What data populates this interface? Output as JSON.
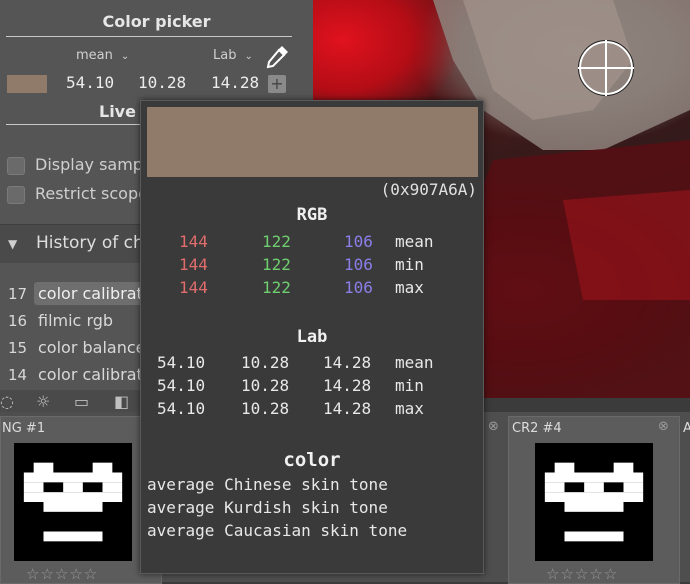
{
  "colors": {
    "sample": "#907A6A",
    "r": "#e06c6c",
    "g": "#6fcf6f",
    "b": "#8a7ee8"
  },
  "picker": {
    "title": "Color picker",
    "stat_mode": "mean",
    "color_mode": "Lab",
    "values": [
      "54.10",
      "10.28",
      "14.28"
    ],
    "add_label": "+"
  },
  "live_samples": {
    "title": "Live s",
    "display_samples": "Display sample",
    "restrict_scope": "Restrict scope"
  },
  "history": {
    "title": "History of cha",
    "items": [
      {
        "num": "17",
        "name": "color calibrati"
      },
      {
        "num": "16",
        "name": "filmic rgb"
      },
      {
        "num": "15",
        "name": "color balance"
      },
      {
        "num": "14",
        "name": "color calibrati"
      }
    ]
  },
  "filmstrip": {
    "thumbs": [
      {
        "label": "NG #1"
      },
      {
        "label": "CR2 #4"
      },
      {
        "label": "A"
      }
    ],
    "stars": "☆☆☆☆☆"
  },
  "tooltip": {
    "hex": "(0x907A6A)",
    "rgb_title": "RGB",
    "rgb_rows": [
      {
        "r": "144",
        "g": "122",
        "b": "106",
        "stat": "mean"
      },
      {
        "r": "144",
        "g": "122",
        "b": "106",
        "stat": "min"
      },
      {
        "r": "144",
        "g": "122",
        "b": "106",
        "stat": "max"
      }
    ],
    "lab_title": "Lab",
    "lab_rows": [
      {
        "l": "54.10",
        "a": "10.28",
        "b": "14.28",
        "stat": "mean"
      },
      {
        "l": "54.10",
        "a": "10.28",
        "b": "14.28",
        "stat": "min"
      },
      {
        "l": "54.10",
        "a": "10.28",
        "b": "14.28",
        "stat": "max"
      }
    ],
    "color_title": "color",
    "color_lines": [
      "average Chinese skin tone",
      "average Kurdish skin tone",
      "average Caucasian skin tone"
    ]
  }
}
